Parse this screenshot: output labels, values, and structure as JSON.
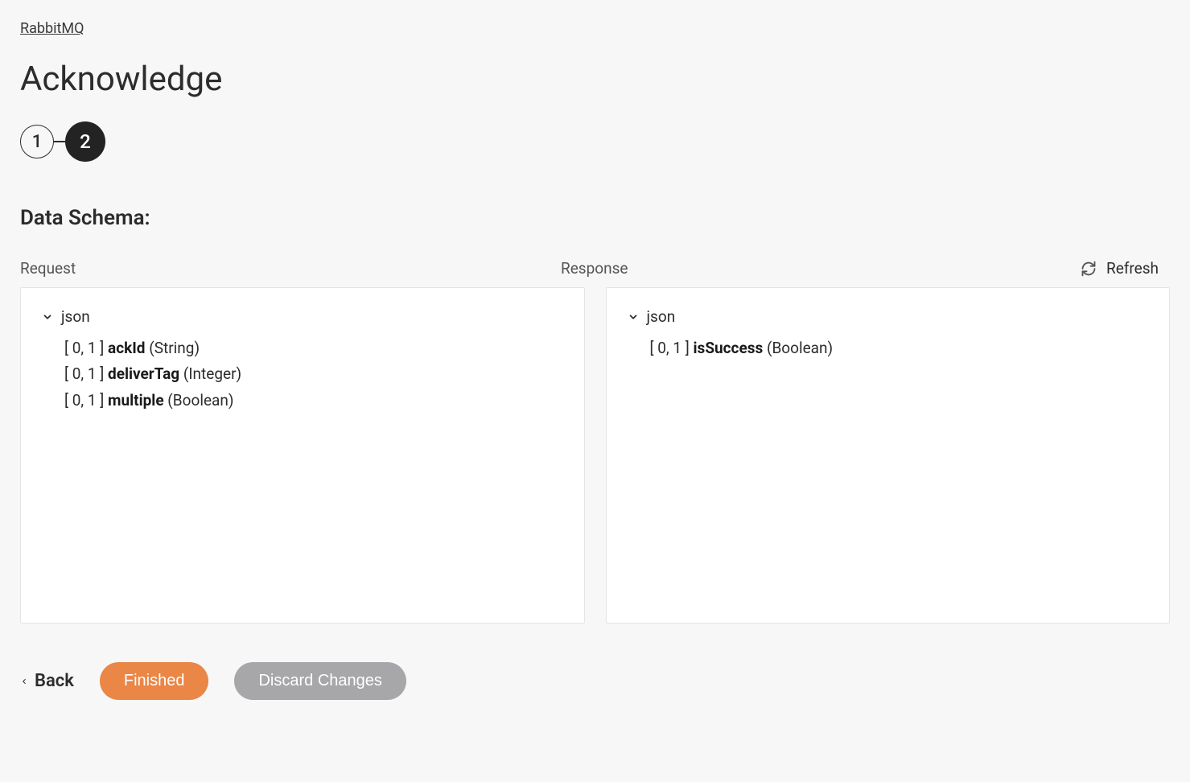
{
  "breadcrumb": "RabbitMQ",
  "title": "Acknowledge",
  "stepper": {
    "step1": "1",
    "step2": "2"
  },
  "section_title": "Data Schema:",
  "refresh_label": "Refresh",
  "request": {
    "label": "Request",
    "root": "json",
    "fields": [
      {
        "cardinality": "[ 0, 1 ]",
        "name": "ackId",
        "type": "(String)"
      },
      {
        "cardinality": "[ 0, 1 ]",
        "name": "deliverTag",
        "type": "(Integer)"
      },
      {
        "cardinality": "[ 0, 1 ]",
        "name": "multiple",
        "type": "(Boolean)"
      }
    ]
  },
  "response": {
    "label": "Response",
    "root": "json",
    "fields": [
      {
        "cardinality": "[ 0, 1 ]",
        "name": "isSuccess",
        "type": "(Boolean)"
      }
    ]
  },
  "actions": {
    "back": "Back",
    "finished": "Finished",
    "discard": "Discard Changes"
  }
}
